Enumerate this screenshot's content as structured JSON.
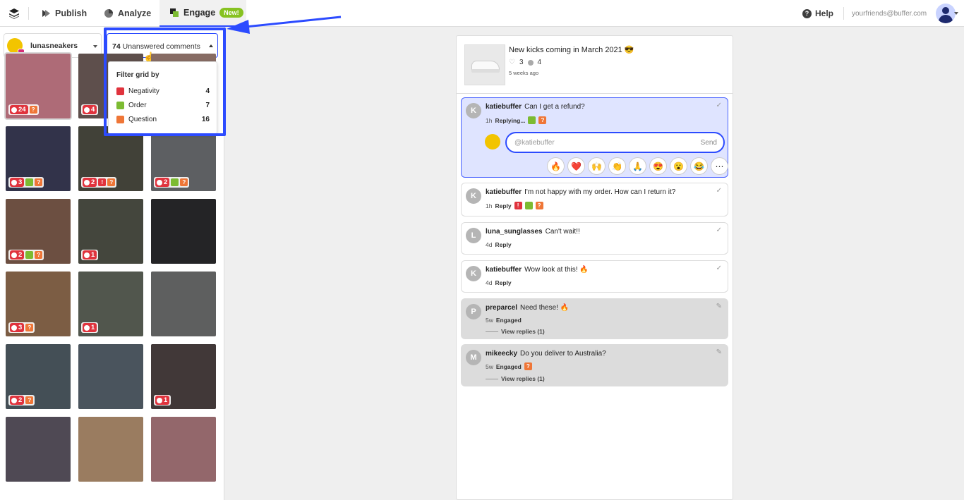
{
  "nav": {
    "publish": "Publish",
    "analyze": "Analyze",
    "engage": "Engage",
    "engage_badge": "New!",
    "help": "Help",
    "email": "yourfriends@buffer.com"
  },
  "account": {
    "name": "lunasneakers"
  },
  "filter": {
    "count": "74",
    "label": "Unanswered comments",
    "heading": "Filter grid by",
    "items": [
      {
        "label": "Negativity",
        "count": "4",
        "color": "#e0333d",
        "icon": "exclamation-icon"
      },
      {
        "label": "Order",
        "count": "7",
        "color": "#7cbb32",
        "icon": "cart-icon"
      },
      {
        "label": "Question",
        "count": "16",
        "color": "#ef7637",
        "icon": "question-icon"
      }
    ]
  },
  "grid": [
    {
      "count": "24",
      "tags": [
        "que"
      ],
      "color": "#c77a88"
    },
    {
      "count": "4",
      "tags": [],
      "color": "#6b5a57"
    },
    {
      "count": "",
      "tags": [],
      "color": "#9a7b72"
    },
    {
      "count": "3",
      "tags": [
        "ord",
        "que"
      ],
      "color": "#3a3b55"
    },
    {
      "count": "2",
      "tags": [
        "neg",
        "que"
      ],
      "color": "#4a4a40"
    },
    {
      "count": "2",
      "tags": [
        "ord",
        "que"
      ],
      "color": "#6a6d70"
    },
    {
      "count": "2",
      "tags": [
        "ord",
        "que"
      ],
      "color": "#7b5b4b"
    },
    {
      "count": "1",
      "tags": [],
      "color": "#4e5046"
    },
    {
      "count": "",
      "tags": [],
      "color": "#2a2a2c"
    },
    {
      "count": "3",
      "tags": [
        "que"
      ],
      "color": "#8e6a4e"
    },
    {
      "count": "1",
      "tags": [],
      "color": "#5d6258"
    },
    {
      "count": "",
      "tags": [],
      "color": "#6c6d6d"
    },
    {
      "count": "2",
      "tags": [
        "que"
      ],
      "color": "#4e5a62"
    },
    {
      "count": "",
      "tags": [],
      "color": "#55606a"
    },
    {
      "count": "1",
      "tags": [],
      "color": "#4a4040"
    },
    {
      "count": "",
      "tags": [],
      "color": "#5a5460"
    },
    {
      "count": "",
      "tags": [],
      "color": "#b08e6e"
    },
    {
      "count": "",
      "tags": [],
      "color": "#a8767a"
    }
  ],
  "post": {
    "title": "New kicks coming in March 2021 😎",
    "likes": "3",
    "comments": "4",
    "time": "5 weeks ago"
  },
  "comments": [
    {
      "initial": "K",
      "user": "katiebuffer",
      "text": "Can I get a refund?",
      "time": "1h",
      "action": "Replying...",
      "tags": [
        "ord",
        "que"
      ],
      "state": "active"
    },
    {
      "initial": "K",
      "user": "katiebuffer",
      "text": "I'm not happy with my order. How can I return it?",
      "time": "1h",
      "action": "Reply",
      "tags": [
        "neg",
        "ord",
        "que"
      ],
      "state": "open"
    },
    {
      "initial": "L",
      "user": "luna_sunglasses",
      "text": "Can't wait!!",
      "time": "4d",
      "action": "Reply",
      "tags": [],
      "state": "open"
    },
    {
      "initial": "K",
      "user": "katiebuffer",
      "text": "Wow look at this! 🔥",
      "time": "4d",
      "action": "Reply",
      "tags": [],
      "state": "open"
    },
    {
      "initial": "P",
      "user": "preparcel",
      "text": "Need these! 🔥",
      "time": "5w",
      "action": "Engaged",
      "tags": [],
      "state": "done",
      "replies": "View replies (1)"
    },
    {
      "initial": "M",
      "user": "mikeecky",
      "text": "Do you deliver to Australia?",
      "time": "5w",
      "action": "Engaged",
      "tags": [
        "que"
      ],
      "state": "done",
      "replies": "View replies (1)"
    }
  ],
  "reply": {
    "placeholder": "@katiebuffer",
    "send": "Send",
    "emojis": [
      "🔥",
      "❤️",
      "🙌",
      "👏",
      "🙏",
      "😍",
      "😮",
      "😂",
      "⋯"
    ]
  }
}
